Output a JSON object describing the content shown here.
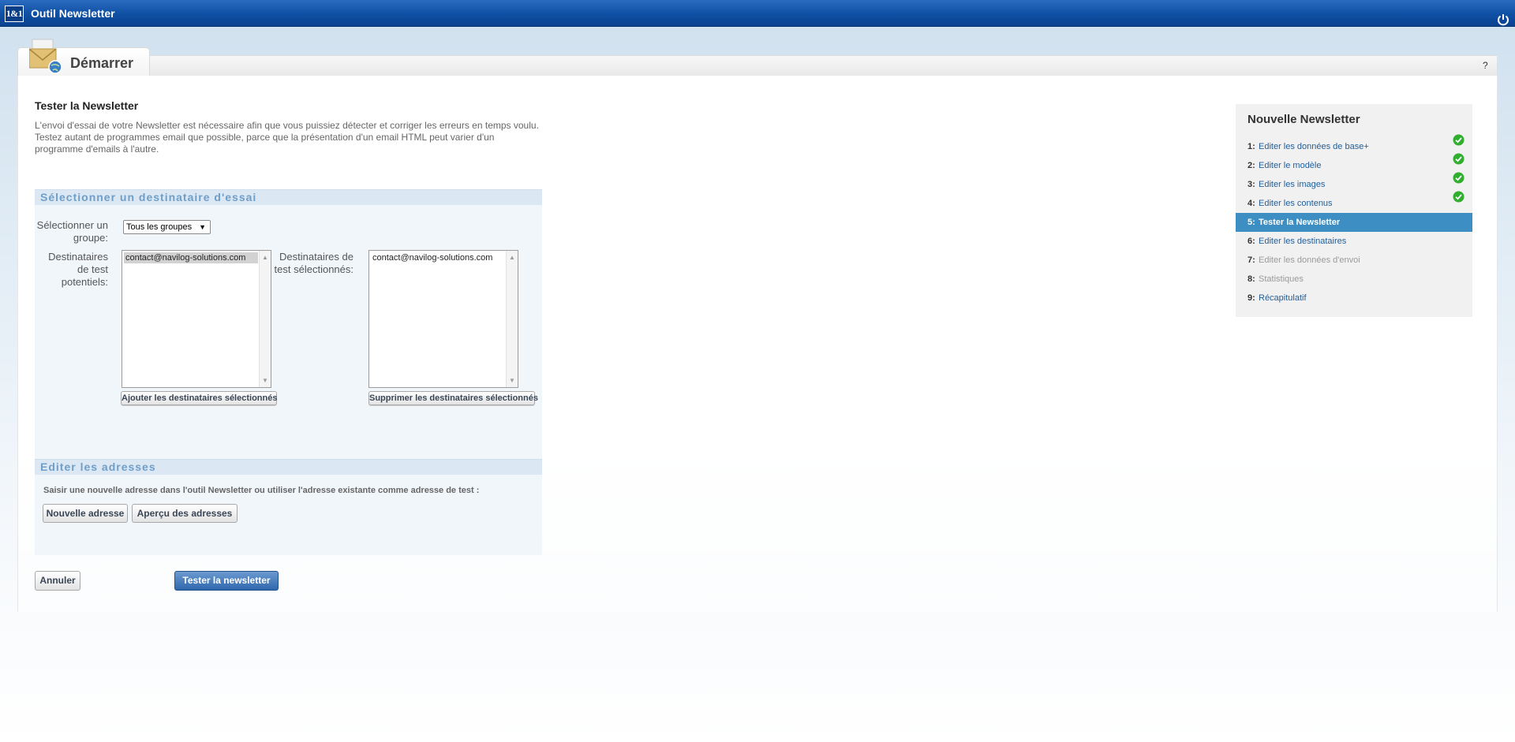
{
  "header": {
    "logo_text": "1&1",
    "app_title": "Outil Newsletter"
  },
  "tab": {
    "label": "Démarrer",
    "help": "?"
  },
  "main": {
    "title": "Tester la Newsletter",
    "intro": "L'envoi d'essai de votre Newsletter est nécessaire afin que vous puissiez détecter et corriger les erreurs en temps voulu. Testez autant de programmes email que possible, parce que la présentation d'un email HTML peut varier d'un programme d'emails à l'autre."
  },
  "recipient_section": {
    "heading": "Sélectionner un destinataire d'essai",
    "group_label": "Sélectionner un groupe:",
    "group_selected": "Tous les groupes",
    "potential_label": "Destinataires de test potentiels:",
    "potential_items": [
      "contact@navilog-solutions.com"
    ],
    "selected_label": "Destinataires de test sélectionnés:",
    "selected_items": [
      "contact@navilog-solutions.com"
    ],
    "add_button": "Ajouter les destinataires sélectionnés",
    "remove_button": "Supprimer les destinataires sélectionnés"
  },
  "address_section": {
    "heading": "Editer les adresses",
    "help_text": "Saisir une nouvelle adresse dans l'outil Newsletter ou utiliser l'adresse existante comme adresse de test :",
    "new_button": "Nouvelle adresse",
    "overview_button": "Aperçu des adresses"
  },
  "actions": {
    "cancel": "Annuler",
    "test": "Tester la newsletter"
  },
  "steps": {
    "title": "Nouvelle Newsletter",
    "items": [
      {
        "num": "1:",
        "label": "Editer les données de base+",
        "done": true,
        "state": "link"
      },
      {
        "num": "2:",
        "label": "Editer le modèle",
        "done": true,
        "state": "link"
      },
      {
        "num": "3:",
        "label": "Editer les images",
        "done": true,
        "state": "link"
      },
      {
        "num": "4:",
        "label": "Editer les contenus",
        "done": true,
        "state": "link"
      },
      {
        "num": "5:",
        "label": "Tester la Newsletter",
        "done": false,
        "state": "active"
      },
      {
        "num": "6:",
        "label": "Editer les destinataires",
        "done": false,
        "state": "link"
      },
      {
        "num": "7:",
        "label": "Editer les données d'envoi",
        "done": false,
        "state": "disabled"
      },
      {
        "num": "8:",
        "label": "Statistiques",
        "done": false,
        "state": "disabled"
      },
      {
        "num": "9:",
        "label": "Récapitulatif",
        "done": false,
        "state": "link"
      }
    ]
  },
  "icons": {
    "power": "power-icon",
    "tab": "envelope-globe-icon",
    "check": "check-icon"
  },
  "colors": {
    "header_blue": "#0f4fa3",
    "active_step": "#3d8ec2",
    "section_header_text": "#6f9ec8",
    "check_green": "#2fae2f"
  }
}
